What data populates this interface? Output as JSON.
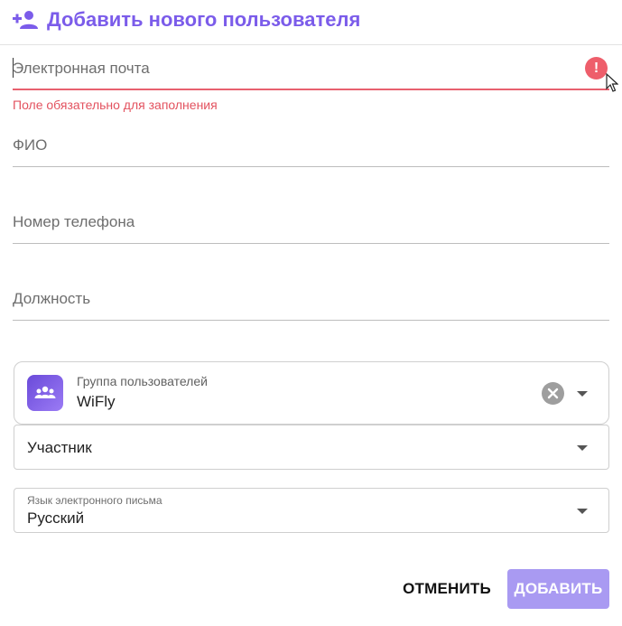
{
  "dialog": {
    "title": "Добавить нового пользователя",
    "title_icon": "person-add-icon"
  },
  "form": {
    "email": {
      "placeholder": "Электронная почта",
      "error": "Поле обязательно для заполнения",
      "error_icon": "exclamation-icon"
    },
    "full_name": {
      "placeholder": "ФИО"
    },
    "phone": {
      "placeholder": "Номер телефона"
    },
    "position": {
      "placeholder": "Должность"
    },
    "user_group": {
      "label": "Группа пользователей",
      "value": "WiFly",
      "avatar_icon": "group-icon",
      "clear_icon": "clear-icon"
    },
    "role": {
      "value": "Участник"
    },
    "email_language": {
      "label": "Язык электронного письма",
      "value": "Русский"
    }
  },
  "actions": {
    "cancel": "ОТМЕНИТЬ",
    "add": "ДОБАВИТЬ"
  },
  "colors": {
    "accent": "#7b5cea",
    "error": "#ee5e6b",
    "primary_disabled": "#a99af2"
  }
}
